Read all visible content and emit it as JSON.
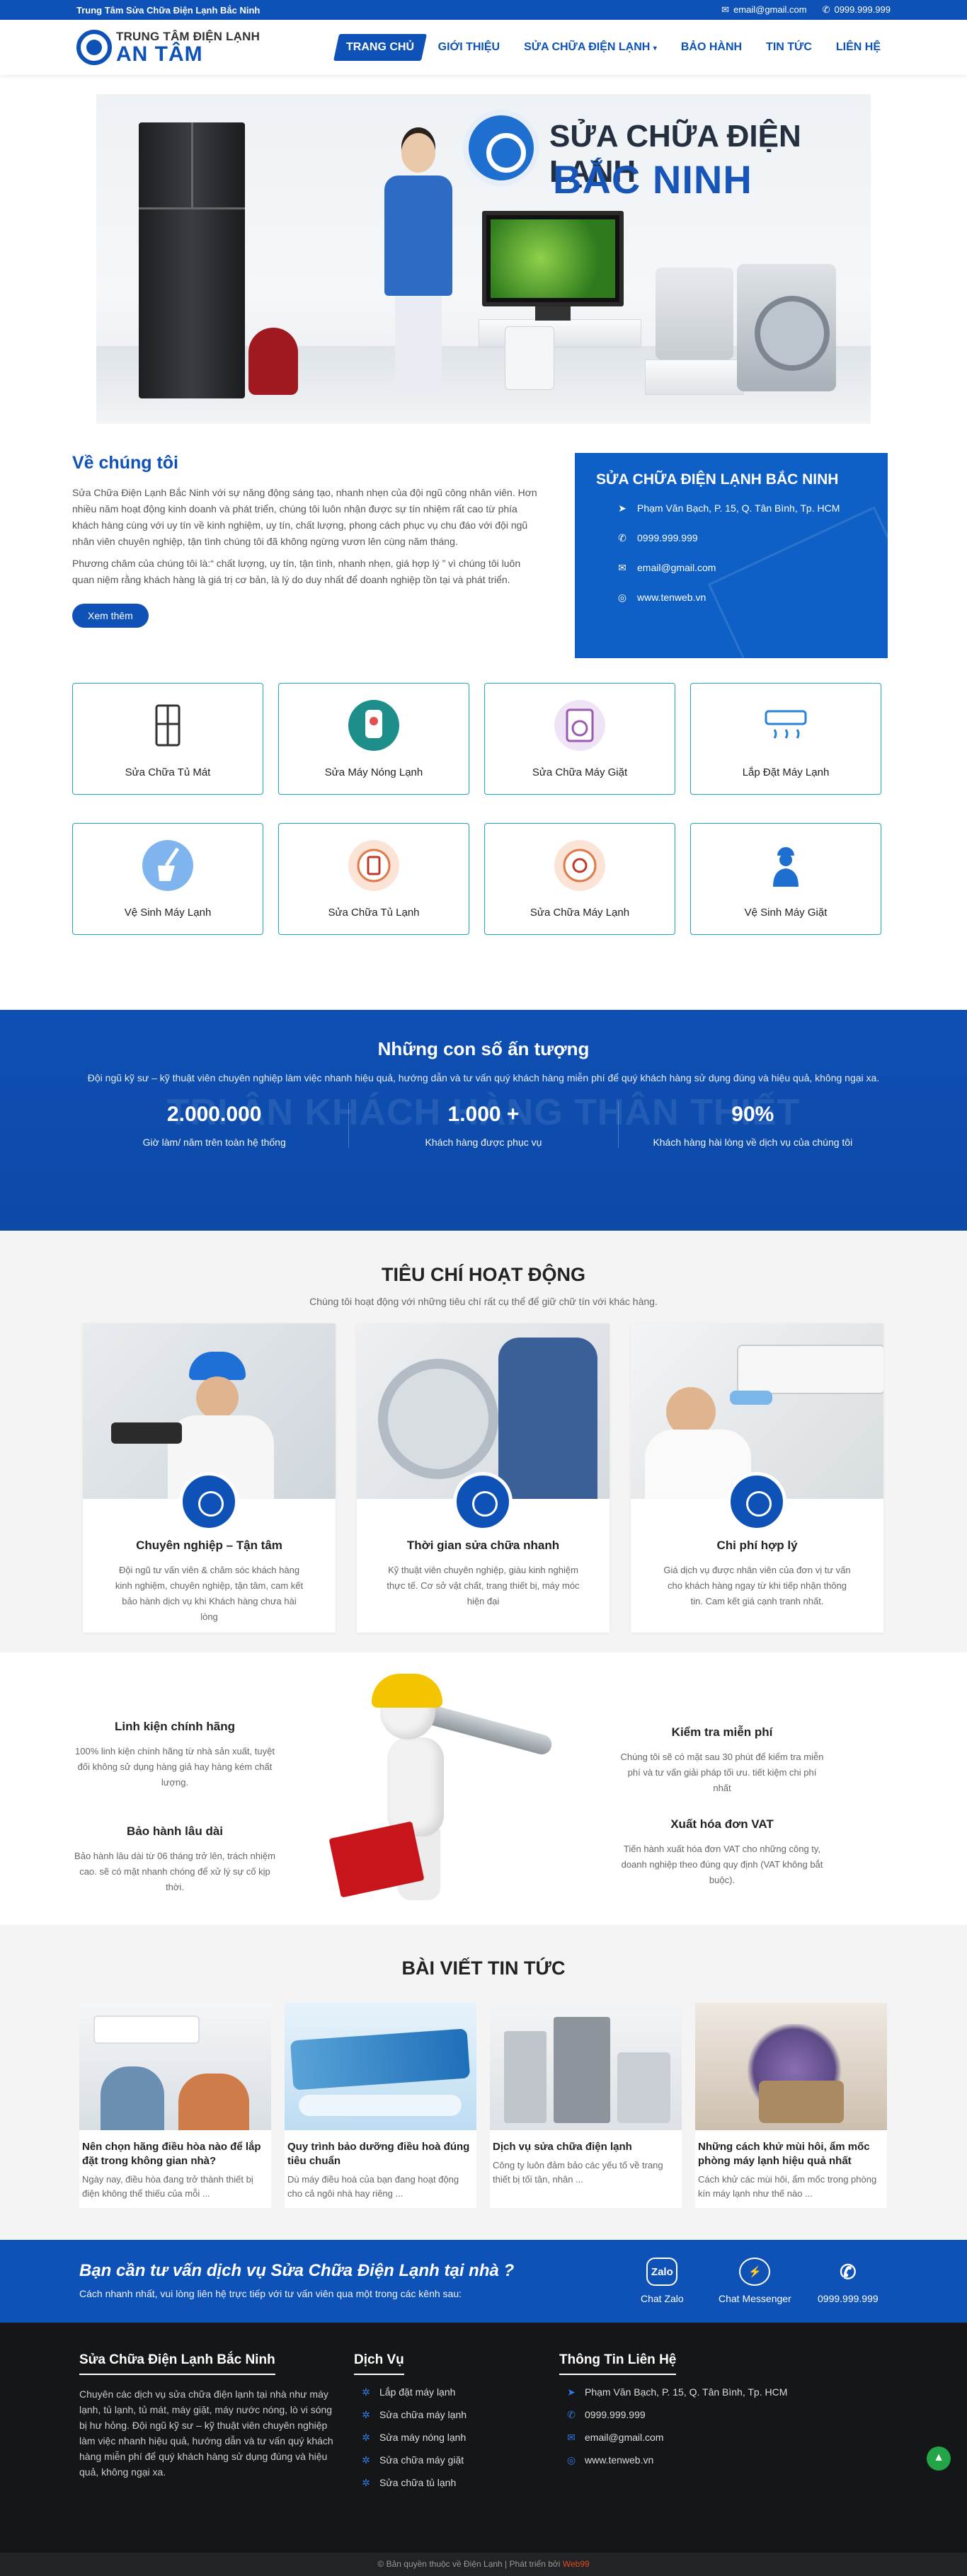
{
  "topbar": {
    "brand": "Trung Tâm Sửa Chữa Điện Lạnh Bắc Ninh",
    "email": "email@gmail.com",
    "phone": "0999.999.999"
  },
  "logo": {
    "line1": "TRUNG TÂM ĐIỆN LẠNH",
    "line2": "AN TÂM"
  },
  "nav": [
    {
      "label": "TRANG CHỦ"
    },
    {
      "label": "GIỚI THIỆU"
    },
    {
      "label": "SỬA CHỮA ĐIỆN LẠNH"
    },
    {
      "label": "BẢO HÀNH"
    },
    {
      "label": "TIN TỨC"
    },
    {
      "label": "LIÊN HỆ"
    }
  ],
  "banner": {
    "title1": "SỬA CHỮA ĐIỆN LẠNH",
    "title2": "BẮC NINH"
  },
  "about": {
    "title": "Về chúng tôi",
    "p1": "Sửa Chữa Điện Lạnh Bắc Ninh với sự năng động sáng tạo, nhanh nhẹn của đội ngũ công nhân viên. Hơn nhiều năm hoạt động kinh doanh và phát triển, chúng tôi luôn nhận được sự tín nhiệm rất cao từ phía khách hàng cùng với uy tín về kinh nghiệm, uy tín, chất lượng, phong cách phục vụ chu đáo với đội ngũ nhân viên chuyên nghiệp, tận tình chúng tôi đã không ngừng vươn lên cùng năm tháng.",
    "p2": "Phương châm của chúng tôi là:“ chất lượng, uy tín, tận tình, nhanh nhẹn, giá hợp lý ” vì chúng tôi luôn quan niệm rằng khách hàng là giá trị cơ bản, là lý do duy nhất để doanh nghiệp tồn tại và phát triển.",
    "button": "Xem thêm"
  },
  "contact_card": {
    "title": "SỬA CHỮA ĐIỆN LẠNH BẮC NINH",
    "address": "Phạm Văn Bạch, P. 15, Q. Tân Bình, Tp. HCM",
    "phone": "0999.999.999",
    "email": "email@gmail.com",
    "website": "www.tenweb.vn"
  },
  "services": [
    {
      "label": "Sửa Chữa Tủ Mát",
      "icon": "fridge-icon"
    },
    {
      "label": "Sửa Máy Nóng Lạnh",
      "icon": "water-heater-icon"
    },
    {
      "label": "Sửa Chữa Máy Giặt",
      "icon": "washing-machine-icon"
    },
    {
      "label": "Lắp Đặt Máy Lạnh",
      "icon": "air-conditioner-icon"
    },
    {
      "label": "Vệ Sinh Máy Lạnh",
      "icon": "cleaning-icon"
    },
    {
      "label": "Sửa Chữa Tủ Lạnh",
      "icon": "fridge-repair-icon"
    },
    {
      "label": "Sửa Chữa Máy Lạnh",
      "icon": "ac-repair-icon"
    },
    {
      "label": "Vệ Sinh Máy Giặt",
      "icon": "technician-icon"
    }
  ],
  "stats": {
    "title": "Những con số ấn tượng",
    "subtitle": "Đội ngũ kỹ sư – kỹ thuật viên chuyên nghiệp làm việc nhanh hiệu quả, hướng dẫn và tư vấn quý khách hàng miễn phí để quý khách hàng sử dụng đúng và hiệu quả, không ngại xa.",
    "ghost": "TRI ÂN KHÁCH HÀNG THÂN THIẾT",
    "items": [
      {
        "value": "2.000.000",
        "caption": "Giờ làm/ năm trên toàn hệ thống"
      },
      {
        "value": "1.000 +",
        "caption": "Khách hàng được phục vụ"
      },
      {
        "value": "90%",
        "caption": "Khách hàng hài lòng về dịch vụ của chúng tôi"
      }
    ]
  },
  "criteria": {
    "title": "TIÊU CHÍ HOẠT ĐỘNG",
    "subtitle": "Chúng tôi hoạt động với những tiêu chí rất cụ thể để giữ chữ tín với khác hàng.",
    "items": [
      {
        "title": "Chuyên nghiệp – Tận tâm",
        "text": "Đội ngũ tư vấn viên & chăm sóc khách hàng kinh nghiệm, chuyên nghiệp, tận tâm, cam kết bảo hành dịch vụ khi Khách hàng chưa hài lòng"
      },
      {
        "title": "Thời gian sửa chữa nhanh",
        "text": "Kỹ thuật viên chuyên nghiệp, giàu kinh nghiệm thực tế. Cơ sở vật chất, trang thiết bị, máy móc hiện đại"
      },
      {
        "title": "Chi phí hợp lý",
        "text": "Giá dịch vụ được nhân viên của đơn vị tư vấn cho khách hàng ngay từ khi tiếp nhận thông tin. Cam kết giá cạnh tranh nhất."
      }
    ]
  },
  "features": {
    "left": [
      {
        "title": "Linh kiện chính hãng",
        "text": "100% linh kiện chính hãng từ nhà sản xuất, tuyệt đối không sử dụng hàng giả hay hàng kém chất lượng."
      },
      {
        "title": "Bảo hành lâu dài",
        "text": "Bảo hành lâu dài từ 06 tháng trở lên, trách nhiệm cao. sẽ có mặt nhanh chóng để xử lý sự cố kịp thời."
      }
    ],
    "right": [
      {
        "title": "Kiểm tra miễn phí",
        "text": "Chúng tôi sẽ có mặt sau 30 phút để kiểm tra miễn phí và tư vấn giải pháp tối ưu. tiết kiệm chi phí nhất"
      },
      {
        "title": "Xuất hóa đơn VAT",
        "text": "Tiến hành xuất hóa đơn VAT cho những công ty, doanh nghiệp theo đúng quy định (VAT không bắt buộc)."
      }
    ]
  },
  "news": {
    "title": "BÀI VIẾT TIN TỨC",
    "posts": [
      {
        "title": "Nên chọn hãng điều hòa nào để lắp đặt trong không gian nhà?",
        "excerpt": "Ngày nay, điều hòa đang trở thành thiết bị điện không thể thiếu của mỗi ..."
      },
      {
        "title": "Quy trình bảo dưỡng điều hoà đúng tiêu chuẩn",
        "excerpt": "Dù máy điều hoà của bạn đang hoạt động cho cả ngôi nhà hay riêng ..."
      },
      {
        "title": "Dịch vụ sửa chữa điện lạnh",
        "excerpt": "Công ty luôn đảm bảo các yếu tố về trang thiết bị tối tân, nhân ..."
      },
      {
        "title": "Những cách khử mùi hôi, ẩm mốc phòng máy lạnh hiệu quả nhất",
        "excerpt": "Cách khử các mùi hôi, ẩm mốc trong phòng kín máy lạnh như thế nào ..."
      }
    ]
  },
  "cta": {
    "title": "Bạn cần tư vấn dịch vụ Sửa Chữa Điện Lạnh tại nhà ?",
    "subtitle": "Cách nhanh nhất, vui lòng liên hệ trực tiếp với tư vấn viên qua một trong các kênh sau:",
    "zalo_icon_text": "Zalo",
    "zalo": "Chat Zalo",
    "messenger": "Chat Messenger",
    "phone": "0999.999.999"
  },
  "footer": {
    "col1_title": "Sửa Chữa Điện Lạnh Bắc Ninh",
    "col1_text": "Chuyên các dịch vụ sửa chữa điện lạnh tại nhà như máy lạnh, tủ lạnh, tủ mát, máy giặt, máy nước nóng, lò vi sóng bị hư hỏng. Đội ngũ kỹ sư – kỹ thuật viên chuyên nghiệp làm việc nhanh hiệu quả, hướng dẫn và tư vấn quý khách hàng miễn phí để quý khách hàng sử dụng đúng và hiệu quả, không ngại xa.",
    "col2_title": "Dịch Vụ",
    "services": [
      "Lắp đặt máy lạnh",
      "Sửa chữa máy lạnh",
      "Sửa máy nóng lạnh",
      "Sửa chữa máy giặt",
      "Sửa chữa tủ lạnh"
    ],
    "col3_title": "Thông Tin Liên Hệ",
    "address": "Phạm Văn Bạch, P. 15, Q. Tân Bình, Tp. HCM",
    "phone": "0999.999.999",
    "email": "email@gmail.com",
    "website": "www.tenweb.vn"
  },
  "copyright": {
    "text": "© Bản quyền thuộc về Điện Lạnh | Phát triển bởi ",
    "dev": "Web99"
  },
  "colors": {
    "primary": "#0e52b8",
    "accent_border": "#26a7b8",
    "footer_bg": "#151617",
    "top_button": "#22a447"
  }
}
